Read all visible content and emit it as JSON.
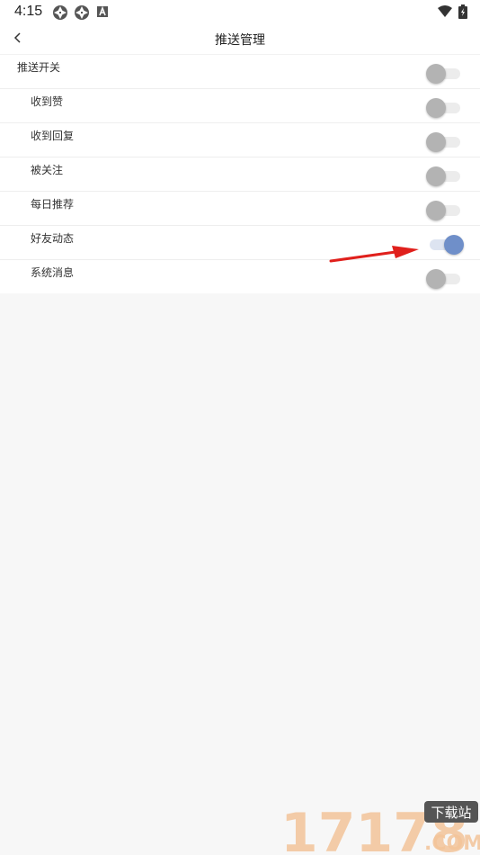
{
  "status_bar": {
    "time": "4:15"
  },
  "nav": {
    "title": "推送管理"
  },
  "settings": [
    {
      "label": "推送开关",
      "enabled": false,
      "level": "master"
    },
    {
      "label": "收到赞",
      "enabled": false,
      "level": "child"
    },
    {
      "label": "收到回复",
      "enabled": false,
      "level": "child"
    },
    {
      "label": "被关注",
      "enabled": false,
      "level": "child"
    },
    {
      "label": "每日推荐",
      "enabled": false,
      "level": "child"
    },
    {
      "label": "好友动态",
      "enabled": true,
      "level": "child"
    },
    {
      "label": "系统消息",
      "enabled": false,
      "level": "child"
    }
  ],
  "colors": {
    "accent": "#6f8fc9",
    "toggle_off": "#b3b3b3",
    "annotation_arrow": "#e0201c"
  },
  "watermark": {
    "site": "17178",
    "badge": "下载站",
    "suffix": ".COM"
  }
}
